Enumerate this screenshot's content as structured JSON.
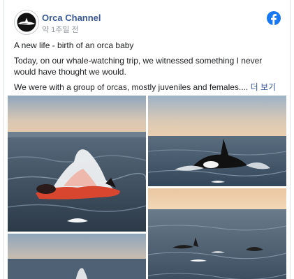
{
  "post": {
    "page_name": "Orca Channel",
    "timestamp": "약 1주일 전",
    "title_line": "A new life - birth of an orca baby",
    "paragraph_1": "Today, on our whale-watching trip, we witnessed something I never would have thought we would.",
    "paragraph_2": "We were with a group of orcas, mostly juveniles and females....",
    "see_more": "더 보기"
  },
  "icons": {
    "avatar": "orca-logo-icon",
    "platform": "facebook-icon"
  },
  "colors": {
    "link": "#385898",
    "facebook_blue": "#1877f2",
    "muted_text": "#90949c",
    "blood_red": "#d9462f"
  }
}
